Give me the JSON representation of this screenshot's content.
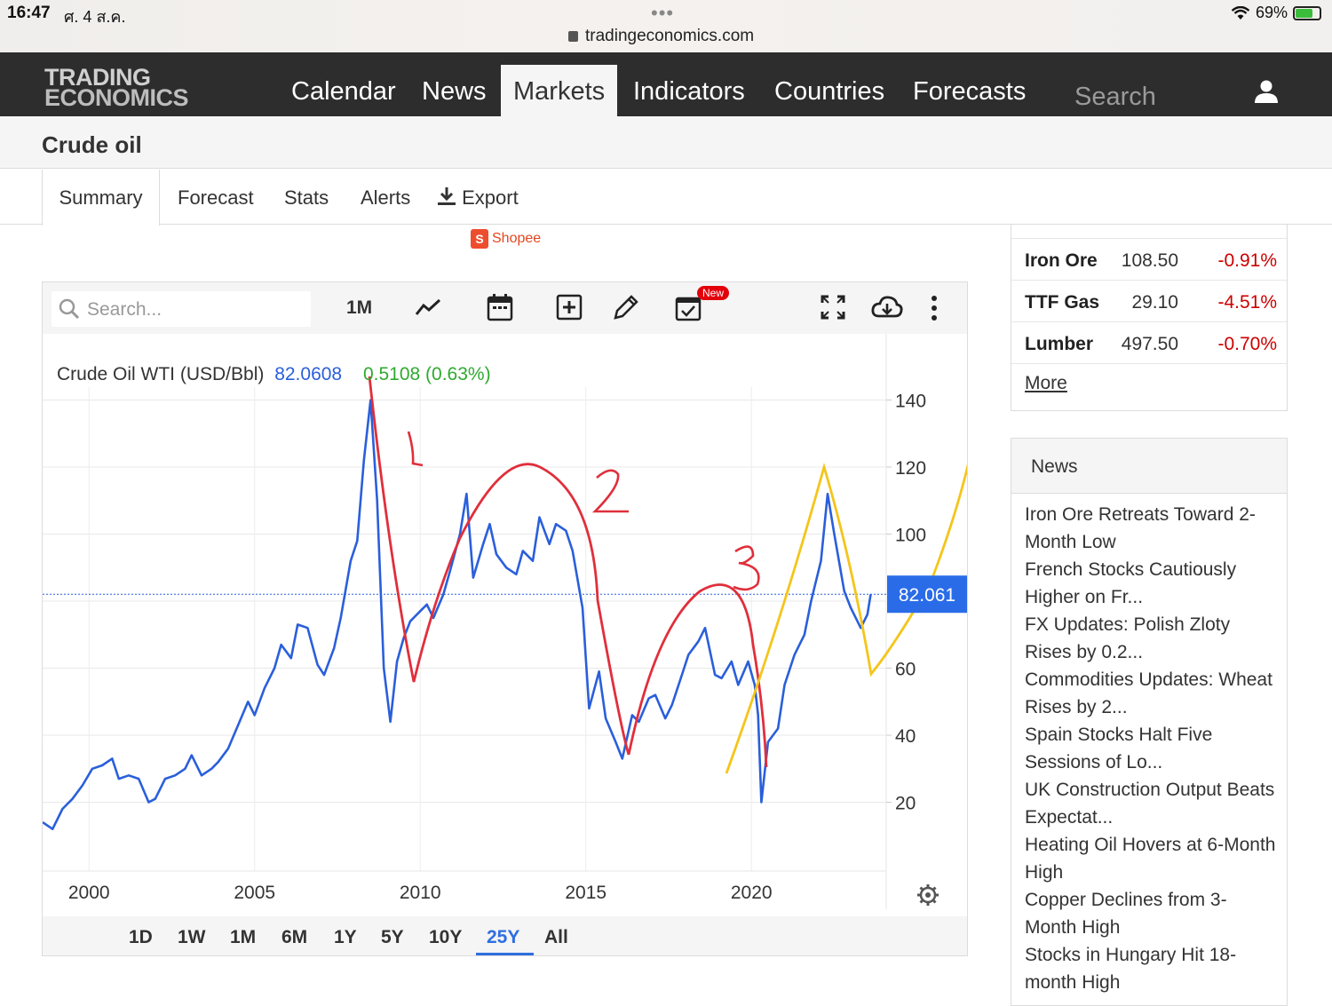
{
  "status_bar": {
    "time": "16:47",
    "date": "ศ. 4 ส.ค.",
    "url": "tradingeconomics.com",
    "battery": "69%"
  },
  "nav": {
    "logo_line1": "TRADING",
    "logo_line2": "ECONOMICS",
    "items": [
      "Calendar",
      "News",
      "Markets",
      "Indicators",
      "Countries",
      "Forecasts"
    ],
    "active": "Markets",
    "search_placeholder": "Search"
  },
  "page": {
    "title": "Crude oil"
  },
  "tabs": {
    "summary": "Summary",
    "forecast": "Forecast",
    "stats": "Stats",
    "alerts": "Alerts",
    "export": "Export"
  },
  "ad": {
    "label": "Shopee"
  },
  "chart_toolbar": {
    "search_placeholder": "Search...",
    "interval": "1M",
    "new_badge": "New"
  },
  "chart_header": {
    "name": "Crude Oil WTI (USD/Bbl)",
    "price": "82.0608",
    "change": "0.5108 (0.63%)"
  },
  "chart_data": {
    "type": "line",
    "title": "Crude Oil WTI (USD/Bbl)",
    "x_ticks": [
      "2000",
      "2005",
      "2010",
      "2015",
      "2020"
    ],
    "y_ticks": [
      20,
      40,
      60,
      80,
      100,
      120,
      140
    ],
    "y_tick_labels": [
      "20",
      "40",
      "60",
      "100",
      "120",
      "140"
    ],
    "xlim": [
      1998.6,
      2024.0
    ],
    "ylim": [
      0,
      148
    ],
    "last_value_label": "82.061",
    "last_value": 82.061,
    "series": [
      {
        "color": "#2a5fdb",
        "x": [
          1998.6,
          1998.9,
          1999.2,
          1999.5,
          1999.8,
          2000.1,
          2000.4,
          2000.7,
          2000.9,
          2001.2,
          2001.5,
          2001.8,
          2002.0,
          2002.3,
          2002.6,
          2002.9,
          2003.1,
          2003.4,
          2003.7,
          2003.9,
          2004.2,
          2004.5,
          2004.8,
          2005.0,
          2005.3,
          2005.6,
          2005.8,
          2006.1,
          2006.3,
          2006.6,
          2006.9,
          2007.1,
          2007.4,
          2007.6,
          2007.9,
          2008.1,
          2008.3,
          2008.5,
          2008.7,
          2008.9,
          2009.1,
          2009.3,
          2009.5,
          2009.7,
          2009.9,
          2010.2,
          2010.4,
          2010.7,
          2010.9,
          2011.2,
          2011.4,
          2011.6,
          2011.9,
          2012.1,
          2012.3,
          2012.6,
          2012.9,
          2013.1,
          2013.4,
          2013.6,
          2013.9,
          2014.1,
          2014.4,
          2014.6,
          2014.9,
          2015.1,
          2015.4,
          2015.6,
          2015.9,
          2016.1,
          2016.4,
          2016.6,
          2016.9,
          2017.1,
          2017.4,
          2017.6,
          2017.9,
          2018.1,
          2018.4,
          2018.6,
          2018.9,
          2019.1,
          2019.4,
          2019.6,
          2019.9,
          2020.1,
          2020.2,
          2020.3,
          2020.5,
          2020.8,
          2021.0,
          2021.3,
          2021.6,
          2021.8,
          2022.1,
          2022.3,
          2022.5,
          2022.8,
          2023.0,
          2023.3,
          2023.5,
          2023.6
        ],
        "values": [
          14,
          12,
          18,
          21,
          25,
          30,
          31,
          33,
          27,
          28,
          27,
          20,
          21,
          27,
          28,
          30,
          34,
          28,
          30,
          32,
          36,
          43,
          50,
          46,
          54,
          60,
          67,
          63,
          73,
          72,
          61,
          58,
          66,
          75,
          92,
          98,
          122,
          140,
          110,
          60,
          44,
          62,
          69,
          74,
          76,
          79,
          75,
          82,
          89,
          100,
          112,
          87,
          97,
          103,
          94,
          90,
          88,
          95,
          92,
          105,
          97,
          103,
          101,
          95,
          78,
          48,
          59,
          45,
          38,
          33,
          46,
          44,
          51,
          52,
          45,
          49,
          58,
          64,
          68,
          72,
          58,
          57,
          62,
          55,
          62,
          55,
          46,
          20,
          38,
          42,
          55,
          64,
          70,
          80,
          92,
          112,
          100,
          83,
          78,
          72,
          76,
          82
        ]
      }
    ],
    "annotations": [
      "1",
      "2",
      "3"
    ]
  },
  "range_buttons": [
    "1D",
    "1W",
    "1M",
    "6M",
    "1Y",
    "5Y",
    "10Y",
    "25Y",
    "All"
  ],
  "range_active": "25Y",
  "commodities": [
    {
      "name": "Iron Ore",
      "price": "108.50",
      "change": "-0.91%"
    },
    {
      "name": "TTF Gas",
      "price": "29.10",
      "change": "-4.51%"
    },
    {
      "name": "Lumber",
      "price": "497.50",
      "change": "-0.70%"
    }
  ],
  "commodities_more": "More",
  "news": {
    "heading": "News",
    "items": [
      "Iron Ore Retreats Toward 2-Month Low",
      "French Stocks Cautiously Higher on Fr...",
      "FX Updates: Polish Zloty Rises by 0.2...",
      "Commodities Updates: Wheat Rises by 2...",
      "Spain Stocks Halt Five Sessions of Lo...",
      "UK Construction Output Beats Expectat...",
      "Heating Oil Hovers at 6-Month High",
      "Copper Declines from 3-Month High",
      "Stocks in Hungary Hit 18-month High"
    ]
  }
}
